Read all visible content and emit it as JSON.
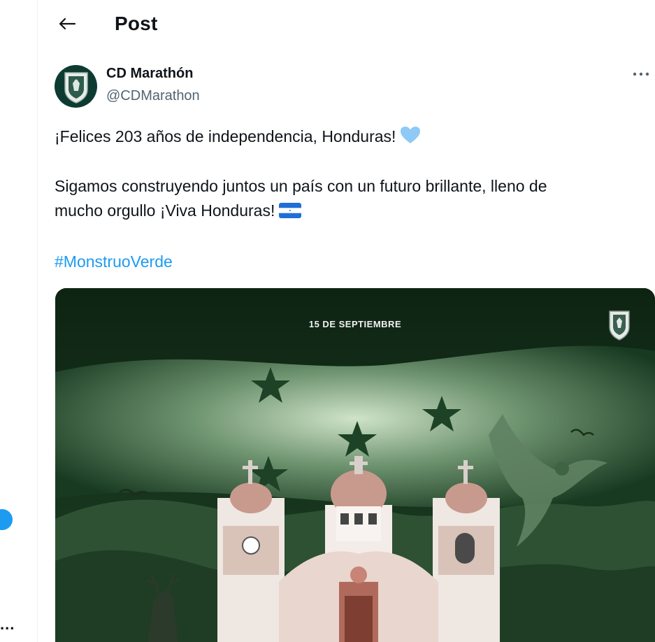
{
  "header": {
    "title": "Post"
  },
  "post": {
    "author": {
      "display_name": "CD Marathón",
      "handle": "@CDMarathon"
    },
    "text_line1": "¡Felices 203 años de independencia, Honduras!",
    "text_line2": "Sigamos construyendo juntos un país con un futuro brillante, lleno de",
    "text_line3": "mucho orgullo ¡Viva Honduras!",
    "hashtag": "#MonstruoVerde",
    "media": {
      "caption": "15 DE SEPTIEMBRE"
    },
    "emoji": [
      "blue-heart",
      "flag-honduras"
    ]
  },
  "rail": {
    "more": "..."
  },
  "icons": {
    "back": "arrow-left-icon",
    "more": "more-horizontal-icon"
  },
  "colors": {
    "accent": "#1d9bf0",
    "text": "#0f1419",
    "secondary": "#536471"
  }
}
